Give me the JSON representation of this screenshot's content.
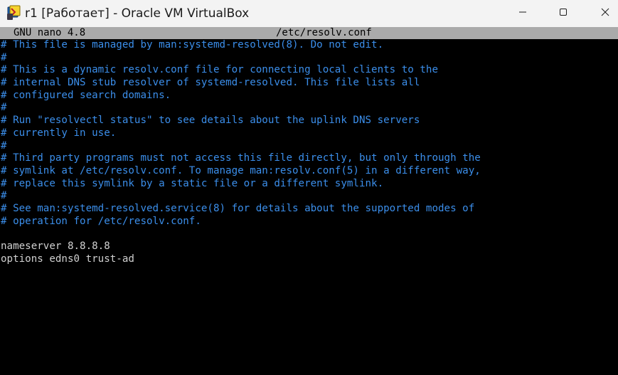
{
  "window": {
    "title": "r1 [Работает] - Oracle VM VirtualBox",
    "app_icon": "virtualbox-icon",
    "controls": {
      "minimize_icon": "minimize-icon",
      "maximize_icon": "maximize-icon",
      "close_icon": "close-icon"
    }
  },
  "nano": {
    "version": "GNU nano 4.8",
    "filename": "/etc/resolv.conf",
    "header_bg": "#aaaaaa",
    "comment_color": "#3b8eea",
    "text_color": "#d0d0d0"
  },
  "content": {
    "lines": [
      "# This file is managed by man:systemd-resolved(8). Do not edit.",
      "#",
      "# This is a dynamic resolv.conf file for connecting local clients to the",
      "# internal DNS stub resolver of systemd-resolved. This file lists all",
      "# configured search domains.",
      "#",
      "# Run \"resolvectl status\" to see details about the uplink DNS servers",
      "# currently in use.",
      "#",
      "# Third party programs must not access this file directly, but only through the",
      "# symlink at /etc/resolv.conf. To manage man:resolv.conf(5) in a different way,",
      "# replace this symlink by a static file or a different symlink.",
      "#",
      "# See man:systemd-resolved.service(8) for details about the supported modes of",
      "# operation for /etc/resolv.conf.",
      "",
      "nameserver 8.8.8.8",
      "options edns0 trust-ad"
    ]
  }
}
